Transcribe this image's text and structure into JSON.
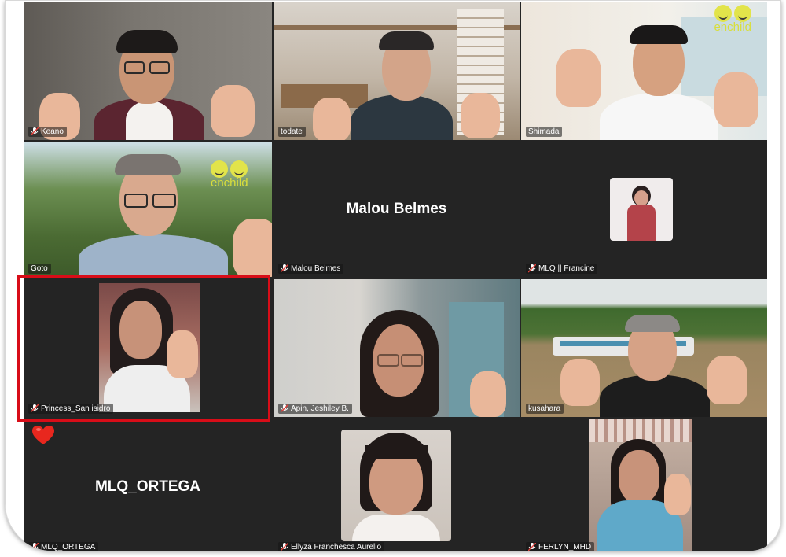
{
  "participants": [
    {
      "name": "Keano",
      "muted": true
    },
    {
      "name": "todate",
      "muted": false,
      "active_speaker": true
    },
    {
      "name": "Shimada",
      "muted": false
    },
    {
      "name": "Goto",
      "muted": false
    },
    {
      "name": "Malou Belmes",
      "muted": true,
      "display": "Malou Belmes"
    },
    {
      "name": "MLQ || Francine",
      "muted": true
    },
    {
      "name": "Princess_San isidro",
      "muted": true
    },
    {
      "name": "Apin, Jeshiley B.",
      "muted": true
    },
    {
      "name": "kusahara",
      "muted": false
    },
    {
      "name": "MLQ_ORTEGA",
      "muted": true,
      "display": "MLQ_ORTEGA"
    },
    {
      "name": "Ellyza Franchesca Aurelio",
      "muted": true
    },
    {
      "name": "FERLYN_MHD",
      "muted": true
    }
  ],
  "logo": {
    "text": "enchild",
    "color": "#e2e44a"
  },
  "colors": {
    "tile_bg": "#242424",
    "highlight": "#d80d18",
    "active_speaker": "#2ecc71",
    "muted_icon": "#e0403a"
  },
  "icons": [
    "muted-mic-icon",
    "heart-icon"
  ]
}
